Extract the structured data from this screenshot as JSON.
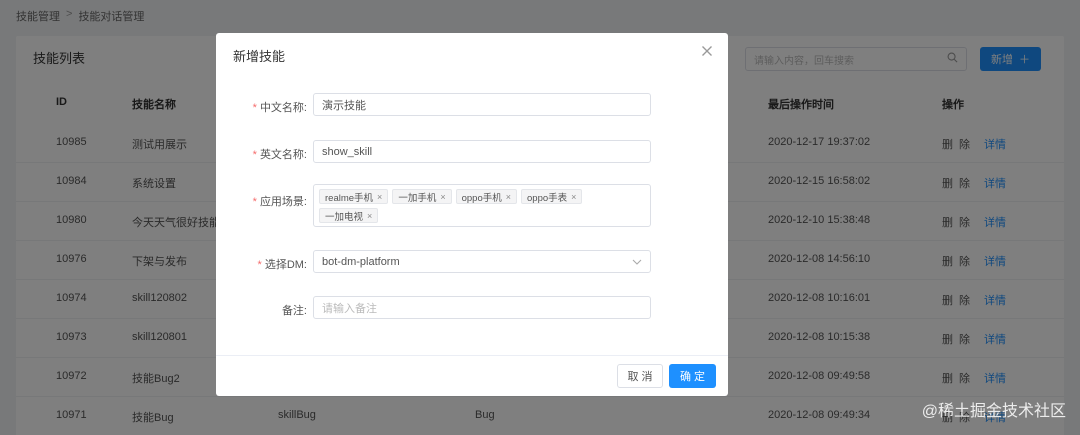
{
  "breadcrumb": {
    "root": "技能管理",
    "separator": ">",
    "current": "技能对话管理"
  },
  "list": {
    "title": "技能列表",
    "search_placeholder": "请输入内容，回车搜索",
    "add_label": "新增",
    "add_icon": "plus-icon",
    "columns": {
      "id": "ID",
      "name": "技能名称",
      "time": "最后操作时间",
      "ops": "操作"
    },
    "rows": [
      {
        "id": "10985",
        "name": "测试用展示",
        "en": "",
        "dm": "",
        "time": "2020-12-17 19:37:02"
      },
      {
        "id": "10984",
        "name": "系统设置",
        "en": "",
        "dm": "",
        "time": "2020-12-15 16:58:02"
      },
      {
        "id": "10980",
        "name": "今天天气很好技能",
        "en": "",
        "dm": "",
        "time": "2020-12-10 15:38:48"
      },
      {
        "id": "10976",
        "name": "下架与发布",
        "en": "",
        "dm": "",
        "time": "2020-12-08 14:56:10"
      },
      {
        "id": "10974",
        "name": "skill120802",
        "en": "",
        "dm": "",
        "time": "2020-12-08 10:16:01"
      },
      {
        "id": "10973",
        "name": "skill120801",
        "en": "",
        "dm": "",
        "time": "2020-12-08 10:15:38"
      },
      {
        "id": "10972",
        "name": "技能Bug2",
        "en": "",
        "dm": "",
        "time": "2020-12-08 09:49:58"
      },
      {
        "id": "10971",
        "name": "技能Bug",
        "en": "skillBug",
        "dm": "Bug",
        "time": "2020-12-08 09:49:34"
      }
    ],
    "op_delete": "删除",
    "op_detail": "详情"
  },
  "dialog": {
    "title": "新增技能",
    "close_icon": "close-icon",
    "fields": {
      "cn_name": {
        "label": "中文名称:",
        "value": "演示技能",
        "required": true
      },
      "en_name": {
        "label": "英文名称:",
        "value": "show_skill",
        "required": true
      },
      "scenes": {
        "label": "应用场景:",
        "required": true,
        "tags": [
          "realme手机",
          "一加手机",
          "oppo手机",
          "oppo手表",
          "一加电视"
        ]
      },
      "dm": {
        "label": "选择DM:",
        "value": "bot-dm-platform",
        "required": true
      },
      "remark": {
        "label": "备注:",
        "placeholder": "请输入备注",
        "required": false
      }
    },
    "required_mark": "*",
    "tag_close": "×",
    "chevron": "⌵",
    "cancel_label": "取 消",
    "ok_label": "确 定"
  },
  "watermark": "@稀土掘金技术社区"
}
